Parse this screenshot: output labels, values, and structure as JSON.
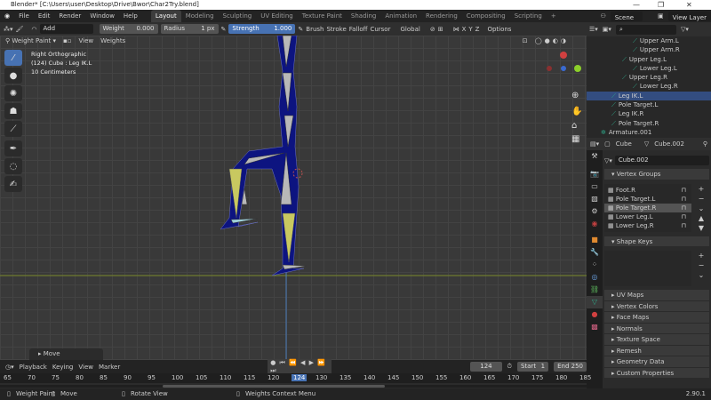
{
  "window": {
    "title": "Blender* [C:\\Users\\user\\Desktop\\Drive\\Bwor\\Char2Try.blend]",
    "min": "—",
    "max": "❐",
    "close": "✕"
  },
  "menu": [
    "File",
    "Edit",
    "Render",
    "Window",
    "Help"
  ],
  "workspaces": [
    "Layout",
    "Modeling",
    "Sculpting",
    "UV Editing",
    "Texture Paint",
    "Shading",
    "Animation",
    "Rendering",
    "Compositing",
    "Scripting",
    "+"
  ],
  "scene": "Scene",
  "view_layer": "View Layer",
  "toolheader": {
    "blend": "Add",
    "weight_label": "Weight",
    "weight_value": "0.000",
    "radius_label": "Radius",
    "radius_value": "1 px",
    "strength_label": "Strength",
    "strength_value": "1.000",
    "brush": "Brush",
    "stroke": "Stroke",
    "falloff": "Falloff",
    "cursor": "Cursor",
    "orientation": "Global",
    "axes": [
      "X",
      "Y",
      "Z"
    ],
    "options": "Options"
  },
  "viewport": {
    "mode": "Weight Paint",
    "menus": [
      "View",
      "Weights"
    ],
    "info": [
      "Right Orthographic",
      "(124) Cube : Leg IK.L",
      "10 Centimeters"
    ],
    "operator_panel": "Move"
  },
  "outliner": {
    "items": [
      {
        "label": "Upper Arm.L",
        "indent": 5
      },
      {
        "label": "Upper Arm.R",
        "indent": 5
      },
      {
        "label": "Upper Leg.L",
        "indent": 4
      },
      {
        "label": "Lower Leg.L",
        "indent": 5
      },
      {
        "label": "Upper Leg.R",
        "indent": 4
      },
      {
        "label": "Lower Leg.R",
        "indent": 5
      },
      {
        "label": "Leg IK.L",
        "indent": 3,
        "selected": true
      },
      {
        "label": "Pole Target.L",
        "indent": 3
      },
      {
        "label": "Leg IK.R",
        "indent": 3
      },
      {
        "label": "Pole Target.R",
        "indent": 3
      },
      {
        "label": "Armature.001",
        "indent": 2
      }
    ]
  },
  "properties": {
    "object": "Cube",
    "mesh": "Cube.002",
    "mesh_field": "Cube.002",
    "vertex_groups_title": "Vertex Groups",
    "vertex_groups": [
      {
        "label": "Foot.R"
      },
      {
        "label": "Pole Target.L"
      },
      {
        "label": "Pole Target.R",
        "selected": true
      },
      {
        "label": "Lower Leg.L"
      },
      {
        "label": "Lower Leg.R"
      }
    ],
    "shape_keys_title": "Shape Keys",
    "panels": [
      "UV Maps",
      "Vertex Colors",
      "Face Maps",
      "Normals",
      "Texture Space",
      "Remesh",
      "Geometry Data",
      "Custom Properties"
    ]
  },
  "timeline": {
    "menus": [
      "Playback",
      "Keying",
      "View",
      "Marker"
    ],
    "current_frame": "124",
    "start_label": "Start",
    "start": "1",
    "end_label": "End",
    "end": "250",
    "ticks": [
      "65",
      "70",
      "75",
      "80",
      "85",
      "90",
      "95",
      "100",
      "105",
      "110",
      "115",
      "120",
      "124",
      "130",
      "135",
      "140",
      "145",
      "150",
      "155",
      "160",
      "165",
      "170",
      "175",
      "180",
      "185"
    ]
  },
  "status": {
    "items": [
      "Weight Paint",
      "Move",
      "Rotate View",
      "Weights Context Menu"
    ],
    "version": "2.90.1"
  }
}
